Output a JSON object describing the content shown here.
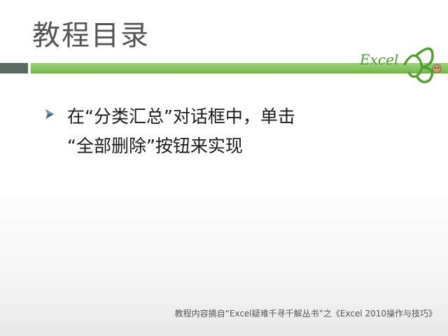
{
  "slide": {
    "title": "教程目录",
    "bullet_text": "在“分类汇总”对话框中，单击\n“全部删除”按钮来实现",
    "footer": "教程内容摘自“Excel疑难千寻千解丛书”之《Excel 2010操作与技巧》",
    "logo_text": "Excel"
  },
  "colors": {
    "accent_green": "#86c45f",
    "dark_band": "#5b6b63",
    "title_gray": "#555555"
  },
  "icons": {
    "bullet": "arrow-bullet-icon",
    "logo": "excel-logo-icon"
  }
}
